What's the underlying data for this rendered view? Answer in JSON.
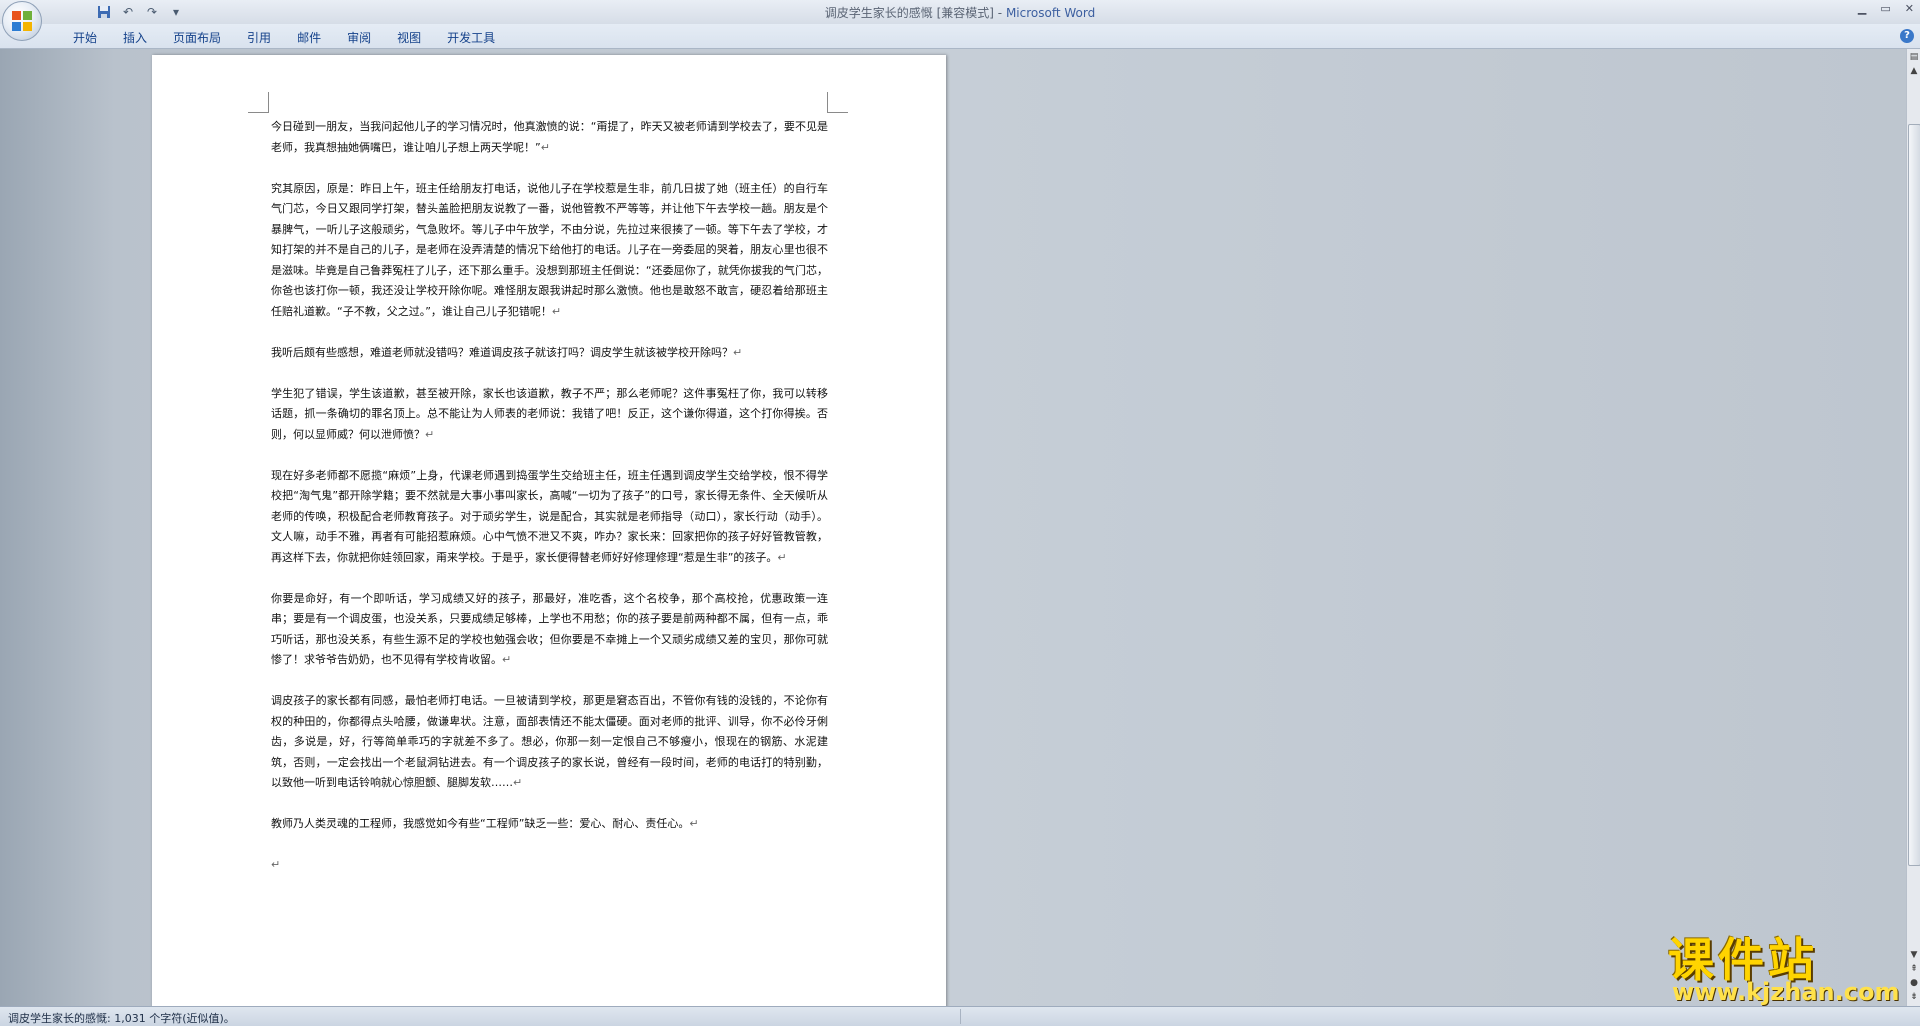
{
  "window": {
    "title_doc": "调皮学生家长的感慨 [兼容模式]",
    "title_sep": " - ",
    "title_app": "Microsoft Word"
  },
  "quick_access": [
    "save-icon",
    "undo-icon",
    "redo-icon",
    "customize-icon"
  ],
  "ribbon": {
    "tabs": [
      "开始",
      "插入",
      "页面布局",
      "引用",
      "邮件",
      "审阅",
      "视图",
      "开发工具"
    ],
    "help": "?"
  },
  "document": {
    "paragraphs": [
      "今日碰到一朋友，当我问起他儿子的学习情况时，他真激愤的说：“甭提了，昨天又被老师请到学校去了，要不见是老师，我真想抽她俩嘴巴，谁让咱儿子想上两天学呢！”",
      "究其原因，原是：昨日上午，班主任给朋友打电话，说他儿子在学校惹是生非，前几日拔了她（班主任）的自行车气门芯，今日又跟同学打架，替头盖脸把朋友说教了一番，说他管教不严等等，并让他下午去学校一趟。朋友是个暴脾气，一听儿子这般顽劣，气急败坏。等儿子中午放学，不由分说，先拉过来很揍了一顿。等下午去了学校，才知打架的并不是自己的儿子，是老师在没弄清楚的情况下给他打的电话。儿子在一旁委屈的哭着，朋友心里也很不是滋味。毕竟是自己鲁莽冤枉了儿子，还下那么重手。没想到那班主任倒说：“还委屈你了，就凭你拔我的气门芯，你爸也该打你一顿，我还没让学校开除你呢。难怪朋友跟我讲起时那么激愤。他也是敢怒不敢言，硬忍着给那班主任赔礼道歉。“子不教，父之过。”，谁让自己儿子犯错呢！",
      "我听后颇有些感想，难道老师就没错吗？难道调皮孩子就该打吗？调皮学生就该被学校开除吗？",
      "学生犯了错误，学生该道歉，甚至被开除，家长也该道歉，教子不严；那么老师呢？这件事冤枉了你，我可以转移话题，抓一条确切的罪名顶上。总不能让为人师表的老师说：我错了吧！反正，这个谦你得道，这个打你得挨。否则，何以显师威？何以泄师愤？",
      "现在好多老师都不愿揽“麻烦”上身，代课老师遇到捣蛋学生交给班主任，班主任遇到调皮学生交给学校，恨不得学校把“淘气鬼”都开除学籍；要不然就是大事小事叫家长，高喊“一切为了孩子”的口号，家长得无条件、全天候听从老师的传唤，积极配合老师教育孩子。对于顽劣学生，说是配合，其实就是老师指导（动口），家长行动（动手）。文人嘛，动手不雅，再者有可能招惹麻烦。心中气愤不泄又不爽，咋办？家长来：回家把你的孩子好好管教管教，再这样下去，你就把你娃领回家，甭来学校。于是乎，家长便得替老师好好修理修理“惹是生非”的孩子。",
      "你要是命好，有一个即听话，学习成绩又好的孩子，那最好，准吃香，这个名校争，那个高校抢，优惠政策一连串；要是有一个调皮蛋，也没关系，只要成绩足够棒，上学也不用愁；你的孩子要是前两种都不属，但有一点，乖巧听话，那也没关系，有些生源不足的学校也勉强会收；但你要是不幸摊上一个又顽劣成绩又差的宝贝，那你可就惨了！求爷爷告奶奶，也不见得有学校肯收留。",
      "调皮孩子的家长都有同感，最怕老师打电话。一旦被请到学校，那更是窘态百出，不管你有钱的没钱的，不论你有权的种田的，你都得点头哈腰，做谦卑状。注意，面部表情还不能太僵硬。面对老师的批评、训导，你不必伶牙俐齿，多说是，好，行等简单乖巧的字就差不多了。想必，你那一刻一定恨自己不够瘦小，恨现在的钢筋、水泥建筑，否则，一定会找出一个老鼠洞钻进去。有一个调皮孩子的家长说，曾经有一段时间，老师的电话打的特别勤，以致他一听到电话铃响就心惊胆颤、腿脚发软……",
      "教师乃人类灵魂的工程师，我感觉如今有些“工程师”缺乏一些：爱心、耐心、责任心。",
      ""
    ],
    "paragraph_mark": "↵"
  },
  "status": {
    "text": "调皮学生家长的感慨: 1,031 个字符(近似值)。"
  },
  "watermark": {
    "main": "课件站",
    "url": "www.kjzhan.com"
  },
  "colors": {
    "title_app": "#3c5fa0",
    "ribbon_tab_text": "#15428b",
    "workspace_bg": "#c6ced7",
    "watermark": "#ffd400"
  }
}
